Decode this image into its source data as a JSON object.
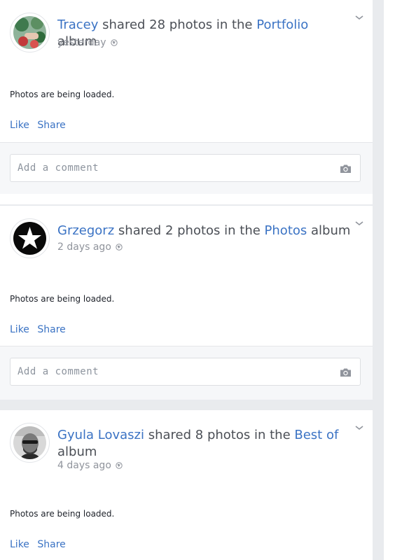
{
  "posts": [
    {
      "author": "Tracey",
      "shared_text": "shared 28 photos in the",
      "album": "Portfolio",
      "album_suffix": "album",
      "time": "yesterday",
      "loading": "Photos are being loaded.",
      "like": "Like",
      "share": "Share",
      "comment_placeholder": "Add a comment"
    },
    {
      "author": "Grzegorz",
      "shared_text": "shared 2 photos in the",
      "album": "Photos",
      "album_suffix": "album",
      "time": "2 days ago",
      "loading": "Photos are being loaded.",
      "like": "Like",
      "share": "Share",
      "comment_placeholder": "Add a comment"
    },
    {
      "author": "Gyula Lovaszi",
      "shared_text": "shared 8 photos in the",
      "album": "Best of",
      "album_suffix": "album",
      "time": "4 days ago",
      "loading": "Photos are being loaded.",
      "like": "Like",
      "share": "Share"
    }
  ],
  "icons": {
    "chevron": "chevron-down-icon",
    "globe": "globe-icon",
    "camera": "camera-icon"
  },
  "colors": {
    "link": "#3b73c4",
    "text": "#4b4f56",
    "muted": "#90949c",
    "feed_bg": "#e9ebee"
  }
}
